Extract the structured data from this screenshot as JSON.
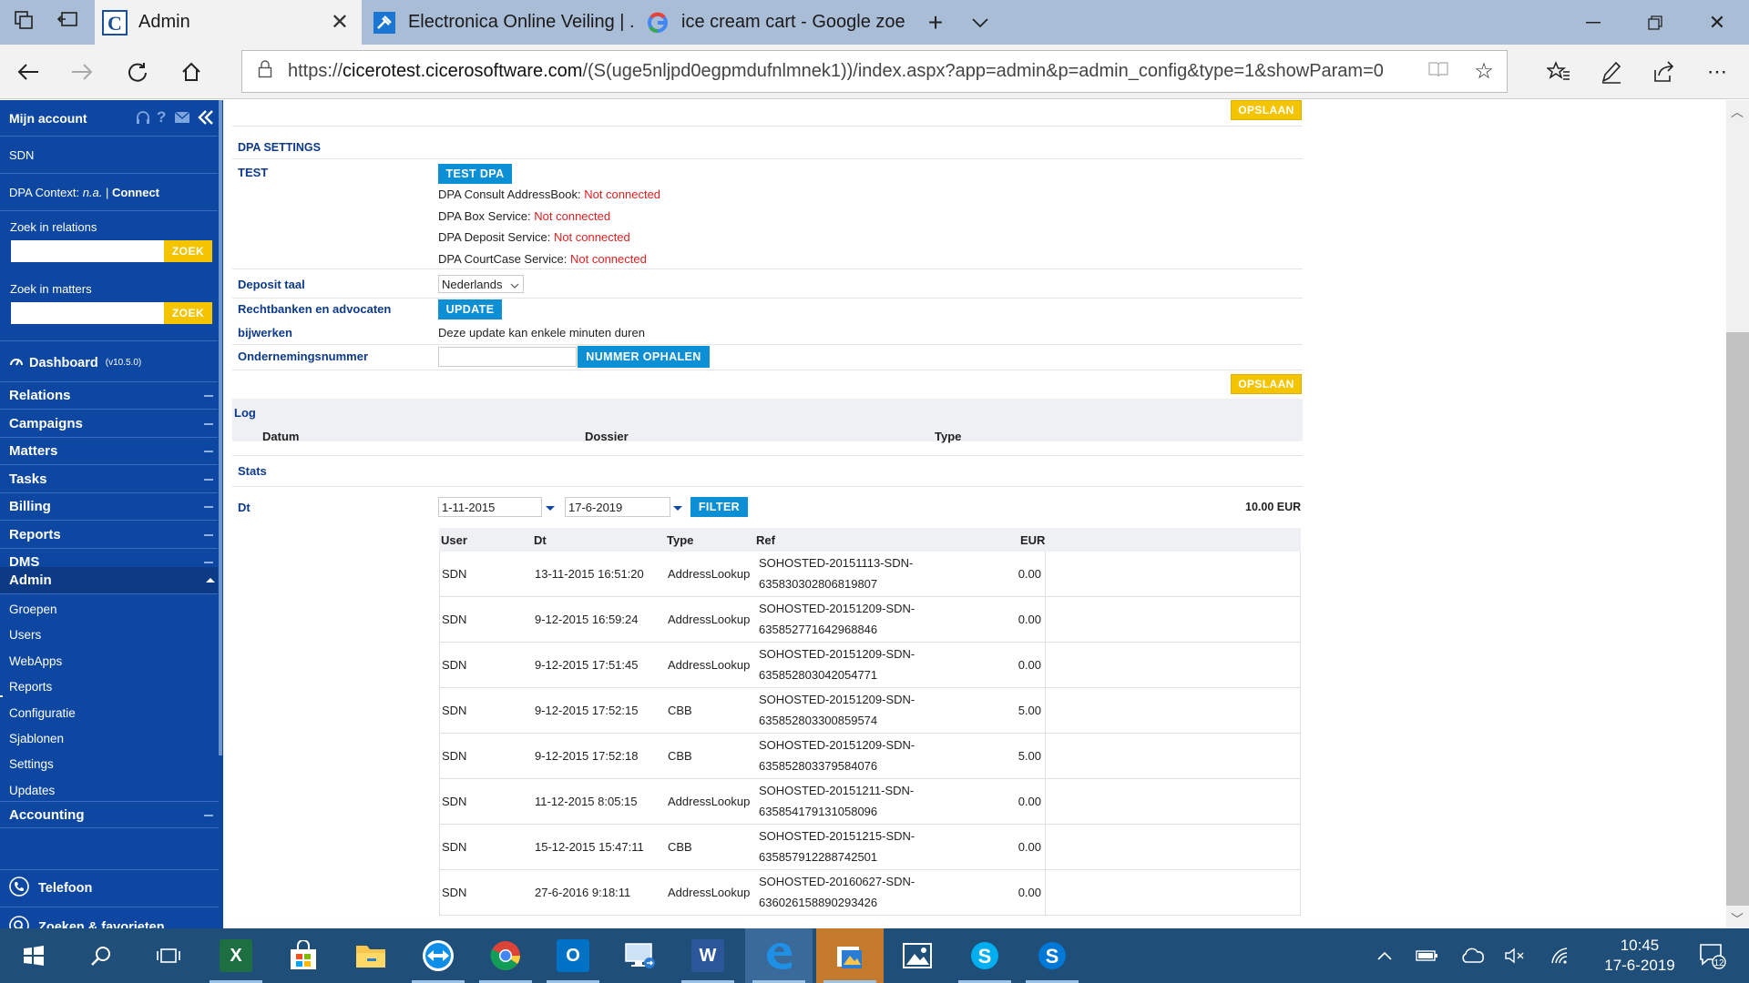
{
  "browser": {
    "tabs": [
      {
        "title": "Admin",
        "active": true
      },
      {
        "title": "Electronica Online Veiling | .",
        "active": false
      },
      {
        "title": "ice cream cart - Google zoe",
        "active": false
      }
    ],
    "url_prefix": "https://",
    "url_host": "cicerotest.cicerosoftware.com",
    "url_rest": "/(S(uge5nljpd0egpmdufnlmnek1))/index.aspx?app=admin&p=admin_config&type=1&showParam=0"
  },
  "sidebar": {
    "account": "Mijn account",
    "user": "SDN",
    "dpa_context_label": "DPA Context:",
    "dpa_context_value": "n.a.",
    "dpa_connect": "Connect",
    "search_relations_label": "Zoek in relations",
    "search_matters_label": "Zoek in matters",
    "zoek": "ZOEK",
    "dashboard": "Dashboard",
    "version": "(v10.5.0)",
    "sections": [
      "Relations",
      "Campaigns",
      "Matters",
      "Tasks",
      "Billing",
      "Reports",
      "DMS"
    ],
    "admin": "Admin",
    "admin_items": [
      "Groepen",
      "Users",
      "WebApps",
      "Reports",
      "Configuratie",
      "Sjablonen",
      "Settings",
      "Updates"
    ],
    "accounting": "Accounting",
    "telefoon": "Telefoon",
    "zoeken": "Zoeken & favorieten"
  },
  "main": {
    "save": "OPSLAAN",
    "dpa_settings": "DPA SETTINGS",
    "test_label": "TEST",
    "test_dpa_button": "TEST DPA",
    "services": [
      {
        "name": "DPA Consult AddressBook:",
        "status": "Not connected"
      },
      {
        "name": "DPA Box Service:",
        "status": "Not connected"
      },
      {
        "name": "DPA Deposit Service:",
        "status": "Not connected"
      },
      {
        "name": "DPA CourtCase Service:",
        "status": "Not connected"
      }
    ],
    "deposit_taal_label": "Deposit taal",
    "deposit_taal_value": "Nederlands",
    "rechtbanken_label_1": "Rechtbanken en advocaten",
    "rechtbanken_label_2": "bijwerken",
    "update_button": "UPDATE",
    "update_note": "Deze update kan enkele minuten duren",
    "ondernemingsnummer_label": "Ondernemingsnummer",
    "nummer_ophalen": "NUMMER OPHALEN",
    "log_title": "Log",
    "log_columns": [
      "Datum",
      "Dossier",
      "Type"
    ],
    "stats_title": "Stats",
    "dt_label": "Dt",
    "date_from": "1-11-2015",
    "date_to": "17-6-2019",
    "filter": "FILTER",
    "total": "10.00 EUR",
    "table_columns": [
      "User",
      "Dt",
      "Type",
      "Ref",
      "EUR"
    ],
    "rows": [
      {
        "user": "SDN",
        "dt": "13-11-2015 16:51:20",
        "type": "AddressLookup",
        "ref1": "SOHOSTED-20151113-SDN-",
        "ref2": "635830302806819807",
        "eur": "0.00"
      },
      {
        "user": "SDN",
        "dt": "9-12-2015 16:59:24",
        "type": "AddressLookup",
        "ref1": "SOHOSTED-20151209-SDN-",
        "ref2": "635852771642968846",
        "eur": "0.00"
      },
      {
        "user": "SDN",
        "dt": "9-12-2015 17:51:45",
        "type": "AddressLookup",
        "ref1": "SOHOSTED-20151209-SDN-",
        "ref2": "635852803042054771",
        "eur": "0.00"
      },
      {
        "user": "SDN",
        "dt": "9-12-2015 17:52:15",
        "type": "CBB",
        "ref1": "SOHOSTED-20151209-SDN-",
        "ref2": "635852803300859574",
        "eur": "5.00"
      },
      {
        "user": "SDN",
        "dt": "9-12-2015 17:52:18",
        "type": "CBB",
        "ref1": "SOHOSTED-20151209-SDN-",
        "ref2": "635852803379584076",
        "eur": "5.00"
      },
      {
        "user": "SDN",
        "dt": "11-12-2015 8:05:15",
        "type": "AddressLookup",
        "ref1": "SOHOSTED-20151211-SDN-",
        "ref2": "635854179131058096",
        "eur": "0.00"
      },
      {
        "user": "SDN",
        "dt": "15-12-2015 15:47:11",
        "type": "CBB",
        "ref1": "SOHOSTED-20151215-SDN-",
        "ref2": "635857912288742501",
        "eur": "0.00"
      },
      {
        "user": "SDN",
        "dt": "27-6-2016 9:18:11",
        "type": "AddressLookup",
        "ref1": "SOHOSTED-20160627-SDN-",
        "ref2": "636026158890293426",
        "eur": "0.00"
      }
    ]
  },
  "taskbar": {
    "time": "10:45",
    "date": "17-6-2019",
    "notifications": "12"
  },
  "colors": {
    "sidebar": "#0d47a1",
    "accent_blue": "#0d8fd6",
    "save_yellow": "#f5c400",
    "error_red": "#e02020",
    "taskbar": "#1f4e79"
  }
}
